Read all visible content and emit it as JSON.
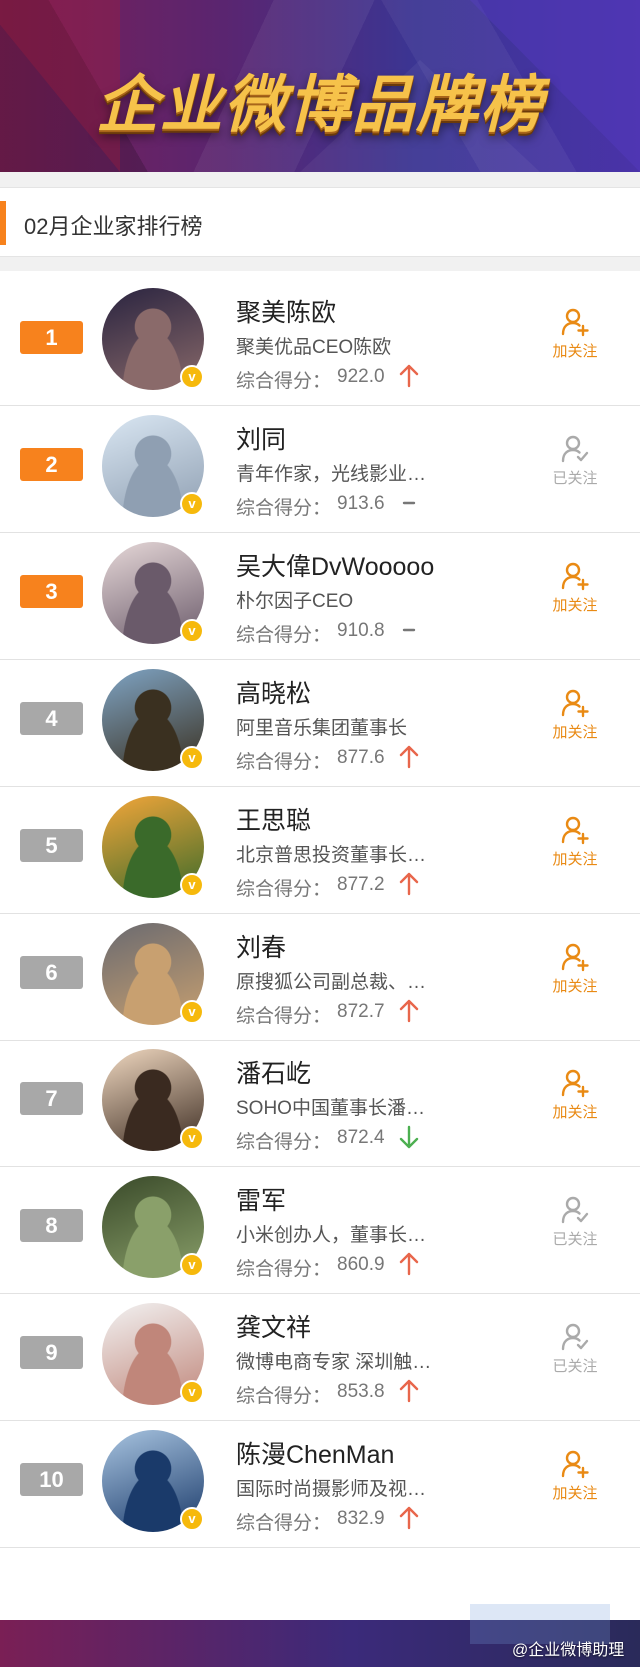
{
  "banner": {
    "title": "企业微博品牌榜"
  },
  "section": {
    "title": "02月企业家排行榜"
  },
  "score_label": "综合得分：",
  "follow_labels": {
    "add": "加关注",
    "done": "已关注"
  },
  "colors": {
    "accent": "#f7821d",
    "rank_top": "#f7821d",
    "rank_other": "#a8a8a8",
    "trend_up": "#e8664b",
    "trend_down": "#4caf50",
    "follow": "#e98a14",
    "followed": "#aaaaaa",
    "verified": "#f6b90c"
  },
  "entries": [
    {
      "rank": "1",
      "name": "聚美陈欧",
      "desc": "聚美优品CEO陈欧",
      "score": "922.0",
      "trend": "up",
      "followed": false,
      "avatar": [
        "#2a2440",
        "#8a6a6a"
      ]
    },
    {
      "rank": "2",
      "name": "刘同",
      "desc": "青年作家，光线影业…",
      "score": "913.6",
      "trend": "flat",
      "followed": true,
      "avatar": [
        "#d9e6f2",
        "#8f9fb2"
      ]
    },
    {
      "rank": "3",
      "name": "吴大偉DvWooooo",
      "desc": "朴尔因子CEO",
      "score": "910.8",
      "trend": "flat",
      "followed": false,
      "avatar": [
        "#e6d8d8",
        "#6a5a6a"
      ]
    },
    {
      "rank": "4",
      "name": "高晓松",
      "desc": "阿里音乐集团董事长",
      "score": "877.6",
      "trend": "up",
      "followed": false,
      "avatar": [
        "#7fa4c4",
        "#3a3020"
      ]
    },
    {
      "rank": "5",
      "name": "王思聪",
      "desc": "北京普思投资董事长…",
      "score": "877.2",
      "trend": "up",
      "followed": false,
      "avatar": [
        "#f3a63a",
        "#3a6a2a"
      ]
    },
    {
      "rank": "6",
      "name": "刘春",
      "desc": "原搜狐公司副总裁、…",
      "score": "872.7",
      "trend": "up",
      "followed": false,
      "avatar": [
        "#6a6a70",
        "#c8a070"
      ]
    },
    {
      "rank": "7",
      "name": "潘石屹",
      "desc": "SOHO中国董事长潘…",
      "score": "872.4",
      "trend": "down",
      "followed": false,
      "avatar": [
        "#f0d8c0",
        "#3a2a20"
      ]
    },
    {
      "rank": "8",
      "name": "雷军",
      "desc": "小米创办人，董事长…",
      "score": "860.9",
      "trend": "up",
      "followed": true,
      "avatar": [
        "#3a4a2a",
        "#8aa06a"
      ]
    },
    {
      "rank": "9",
      "name": "龚文祥",
      "desc": "微博电商专家 深圳触…",
      "score": "853.8",
      "trend": "up",
      "followed": true,
      "avatar": [
        "#f2f2f2",
        "#c0867a"
      ]
    },
    {
      "rank": "10",
      "name": "陈漫ChenMan",
      "desc": "国际时尚摄影师及视…",
      "score": "832.9",
      "trend": "up",
      "followed": false,
      "avatar": [
        "#a8c4e0",
        "#1a3a6a"
      ]
    }
  ],
  "watermark": {
    "text": "@企业微博助理"
  }
}
